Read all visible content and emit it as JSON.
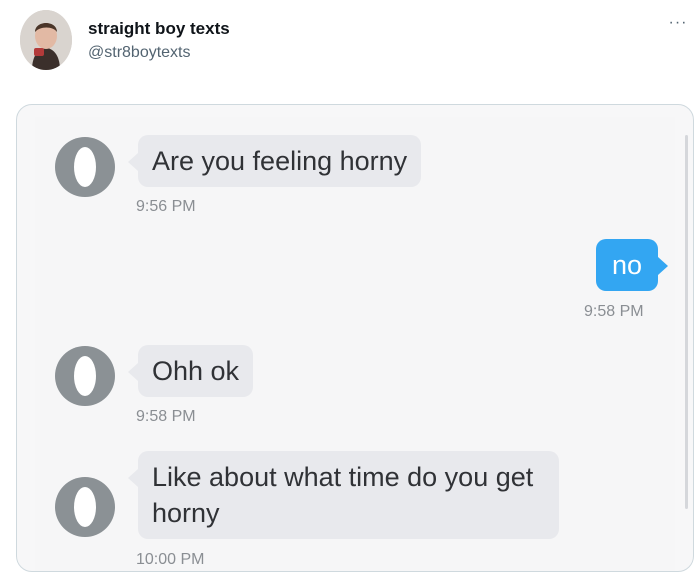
{
  "tweet": {
    "display_name": "straight boy texts",
    "handle": "@str8boytexts",
    "menu_icon": "more-horizontal-icon"
  },
  "messages": [
    {
      "direction": "incoming",
      "text": "Are you feeling horny",
      "time": "9:56 PM"
    },
    {
      "direction": "outgoing",
      "text": "no",
      "time": "9:58 PM"
    },
    {
      "direction": "incoming",
      "text": "Ohh ok",
      "time": "9:58 PM"
    },
    {
      "direction": "incoming",
      "text": "Like about what time do you get horny",
      "time": "10:00 PM"
    }
  ],
  "colors": {
    "incoming_bubble": "#e8e9ed",
    "outgoing_bubble": "#33a6f2",
    "handle_text": "#536471"
  }
}
